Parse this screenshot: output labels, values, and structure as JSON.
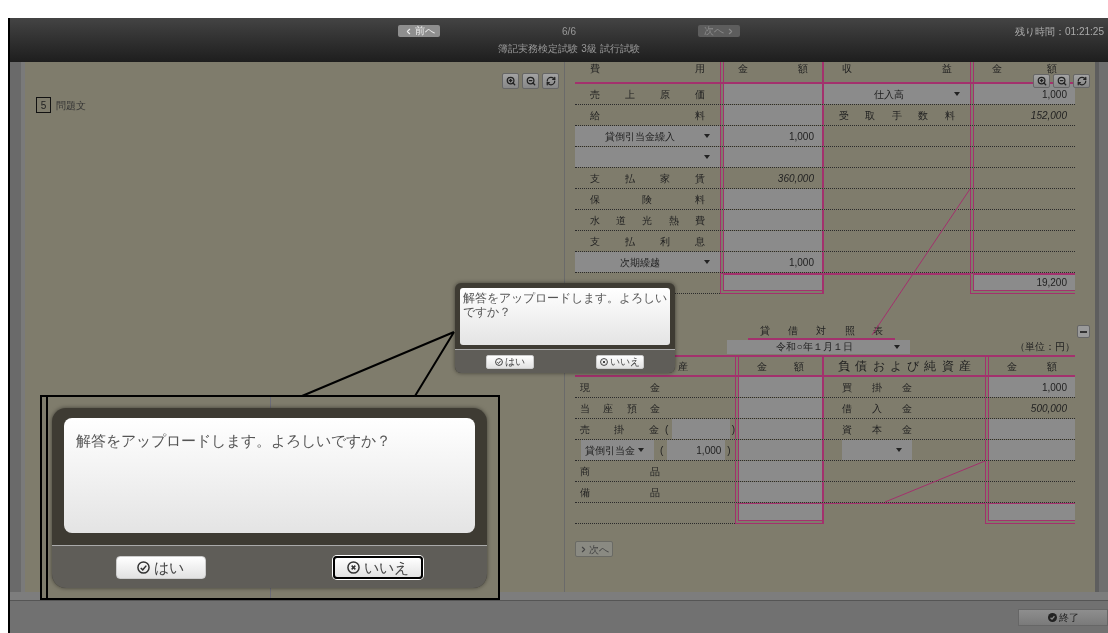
{
  "header": {
    "prev_button": {
      "label": "前へ",
      "disabled": false
    },
    "page_indicator": "6/6",
    "next_button": {
      "label": "次へ",
      "disabled": true
    },
    "exam_title": "簿記実務検定試験 3級 試行試験",
    "time_remaining": "残り時間：01:21:25"
  },
  "question_pane": {
    "number": "5",
    "title": "問題文"
  },
  "income_statement": {
    "header": [
      "費 用",
      "金 額",
      "収 益",
      "金 額"
    ],
    "rows": [
      {
        "left": {
          "kind": "label",
          "label": "売 上 原 価",
          "editable": true
        },
        "right": {
          "kind": "select",
          "value": "仕入高",
          "amount": "1,000",
          "editable": true
        }
      },
      {
        "left": {
          "kind": "label",
          "label": "給 料",
          "editable": true
        },
        "right": {
          "kind": "label",
          "label": "受 取 手 数 料",
          "amount": "152,000",
          "editable": false
        }
      },
      {
        "left": {
          "kind": "select",
          "value": "貸倒引当金繰入",
          "amount": "1,000",
          "editable": true
        }
      },
      {
        "left": {
          "kind": "select",
          "editable": true
        }
      },
      {
        "left": {
          "kind": "label",
          "label": "支 払 家 賃",
          "amount": "360,000",
          "editable": false
        }
      },
      {
        "left": {
          "kind": "label",
          "label": "保 険 料",
          "editable": true
        }
      },
      {
        "left": {
          "kind": "label",
          "label": "水 道 光 熱 費",
          "editable": true
        }
      },
      {
        "left": {
          "kind": "label",
          "label": "支 払 利 息",
          "editable": true
        }
      },
      {
        "left": {
          "kind": "select",
          "value": "次期繰越",
          "amount": "1,000",
          "editable": true
        }
      }
    ],
    "total": {
      "left": {
        "editable": true
      },
      "right": {
        "amount": "19,200",
        "editable": true
      }
    }
  },
  "balance_sheet": {
    "title": "貸 借 対 照 表",
    "date_select": "令和○年１月１日",
    "unit": "（単位：円）",
    "header": [
      "産",
      "金 額",
      "負 債 お よ び 純 資 産",
      "金 額"
    ],
    "rows": [
      {
        "left": {
          "kind": "label",
          "label": "現 金",
          "editable": true
        },
        "right": {
          "kind": "label",
          "label": "買 掛 金",
          "amount": "1,000",
          "editable": true
        }
      },
      {
        "left": {
          "kind": "label",
          "label": "当 座 預 金",
          "editable": true
        },
        "right": {
          "kind": "label",
          "label": "借 入 金",
          "amount": "500,000",
          "editable": false
        }
      },
      {
        "left": {
          "kind": "label",
          "label": "売 掛 金",
          "paren_open": "(",
          "paren_close": ")",
          "editable": true
        },
        "right": {
          "kind": "label",
          "label": "資 本 金",
          "editable": true
        }
      },
      {
        "left": {
          "kind": "select",
          "value": "貸倒引当金",
          "paren_open": "(",
          "sub_value": "1,000",
          "paren_close": ")",
          "editable": true
        },
        "right": {
          "kind": "select_short",
          "editable": true
        }
      },
      {
        "left": {
          "kind": "label",
          "label": "商 品",
          "editable": true
        }
      },
      {
        "left": {
          "kind": "label",
          "label": "備 品",
          "editable": true
        }
      }
    ],
    "total": {
      "left": {
        "editable": true
      },
      "right": {
        "editable": true
      }
    }
  },
  "next_page_button": "次へ",
  "finish_button": "終了",
  "dialog": {
    "message": "解答をアップロードします。よろしいですか？",
    "buttons": [
      {
        "kind": "ok",
        "label": "はい",
        "focused": false
      },
      {
        "kind": "cancel",
        "label": "いいえ",
        "focused": false
      }
    ]
  },
  "magnified_dialog": {
    "message": "解答をアップロードします。よろしいですか？",
    "buttons": [
      {
        "kind": "ok",
        "label": "はい",
        "focused": false
      },
      {
        "kind": "cancel",
        "label": "いいえ",
        "focused": true
      }
    ]
  }
}
